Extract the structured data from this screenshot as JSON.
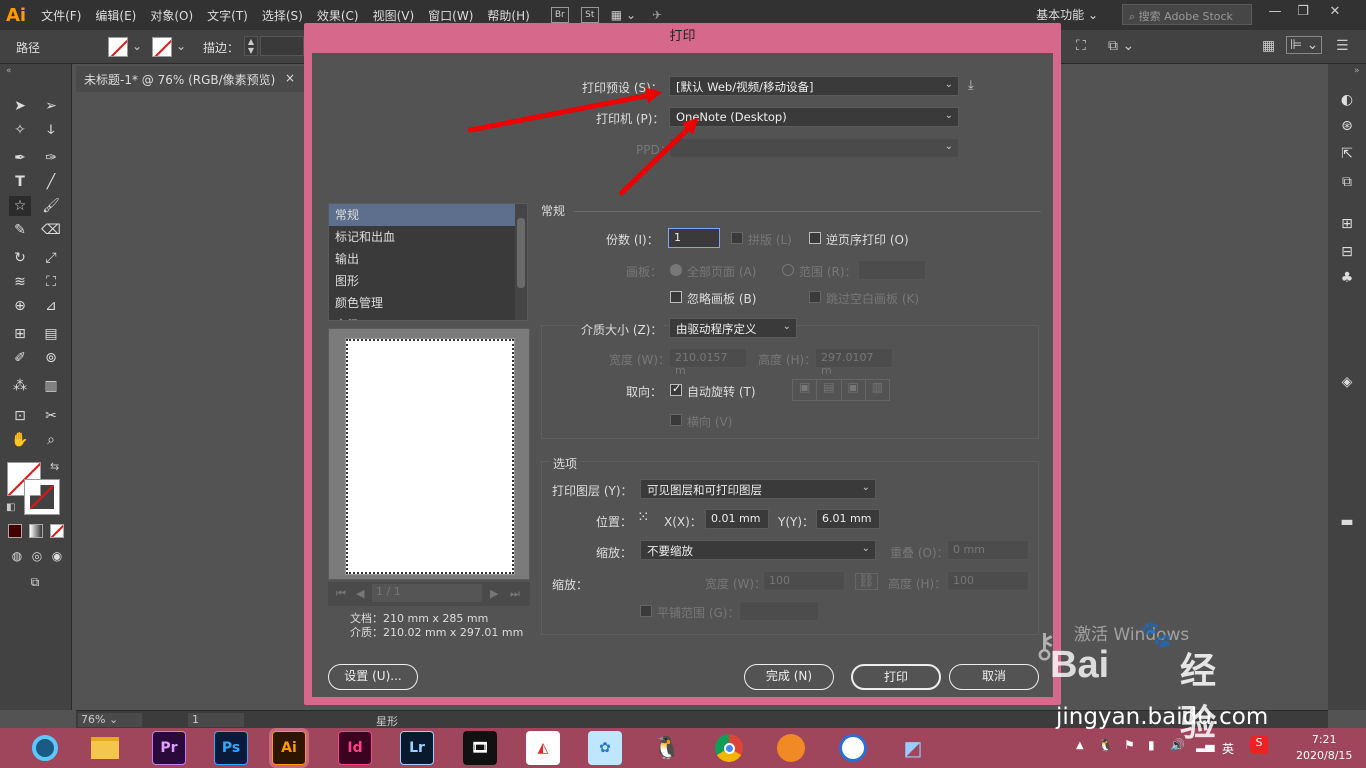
{
  "app": {
    "logo": "Ai",
    "menu": [
      "文件(F)",
      "编辑(E)",
      "对象(O)",
      "文字(T)",
      "选择(S)",
      "效果(C)",
      "视图(V)",
      "窗口(W)",
      "帮助(H)"
    ],
    "bridge": "Br",
    "stock_app": "St",
    "workspace": "基本功能",
    "stock_search_placeholder": "搜索 Adobe Stock"
  },
  "control_bar": {
    "object_type": "路径",
    "stroke_label": "描边："
  },
  "document_tab": {
    "title": "未标题-1* @ 76% (RGB/像素预览)",
    "close": "×"
  },
  "status_bar": {
    "zoom": "76%",
    "artboard": "1",
    "tool": "星形"
  },
  "dialog": {
    "title": "打印",
    "print_preset_label": "打印预设 (S)：",
    "print_preset_value": "[默认 Web/视频/移动设备]",
    "printer_label": "打印机 (P)：",
    "printer_value": "OneNote (Desktop)",
    "ppd_label": "PPD：",
    "categories": [
      "常规",
      "标记和出血",
      "输出",
      "图形",
      "颜色管理",
      "高级"
    ],
    "general": {
      "heading": "常规",
      "copies_label": "份数 (I)：",
      "copies_value": "1",
      "collate_label": "拼版 (L)",
      "reverse_label": "逆页序打印 (O)",
      "artboards_label": "画板：",
      "all_pages_label": "全部页面 (A)",
      "range_label": "范围 (R)：",
      "ignore_artboards_label": "忽略画板 (B)",
      "skip_blank_label": "跳过空白画板 (K)"
    },
    "media": {
      "size_label": "介质大小 (Z)：",
      "size_value": "由驱动程序定义",
      "width_label": "宽度 (W)：",
      "width_value": "210.0157 m",
      "height_label": "高度 (H)：",
      "height_value": "297.0107 m",
      "orientation_label": "取向：",
      "auto_rotate_label": "自动旋转 (T)",
      "landscape_label": "横向 (V)"
    },
    "options": {
      "heading": "选项",
      "layers_label": "打印图层 (Y)：",
      "layers_value": "可见图层和可打印图层",
      "position_label": "位置：",
      "x_label": "X(X)：",
      "x_value": "0.01 mm",
      "y_label": "Y(Y)：",
      "y_value": "6.01 mm",
      "scaling_label": "缩放：",
      "scaling_value": "不要缩放",
      "overlap_label": "重叠 (O)：",
      "overlap_value": "0 mm",
      "scale_label": "缩放：",
      "scale_w_label": "宽度 (W)：",
      "scale_w_value": "100",
      "scale_h_label": "高度 (H)：",
      "scale_h_value": "100",
      "tile_label": "平铺范围 (G)："
    },
    "preview": {
      "page": "1 / 1",
      "doc_label": "文档：210 mm x 285 mm",
      "media_label": "介质：210.02 mm x 297.01 mm"
    },
    "buttons": {
      "setup": "设置 (U)...",
      "done": "完成 (N)",
      "print": "打印",
      "cancel": "取消"
    }
  },
  "taskbar": {
    "apps": [
      "Pr",
      "Ps",
      "Ai",
      "Id",
      "Lr"
    ],
    "ime": "英",
    "time": "7:21",
    "date": "2020/8/15"
  },
  "watermark": {
    "activate": "激活 Windows",
    "site": "jingyan.baidu.com",
    "brand": "Bai",
    "brand_cn": "经验"
  },
  "colors": {
    "dialog_frame": "#d6688c",
    "taskbar": "#a0465c",
    "arrow": "#e00000",
    "selection": "#5d6f8c"
  }
}
